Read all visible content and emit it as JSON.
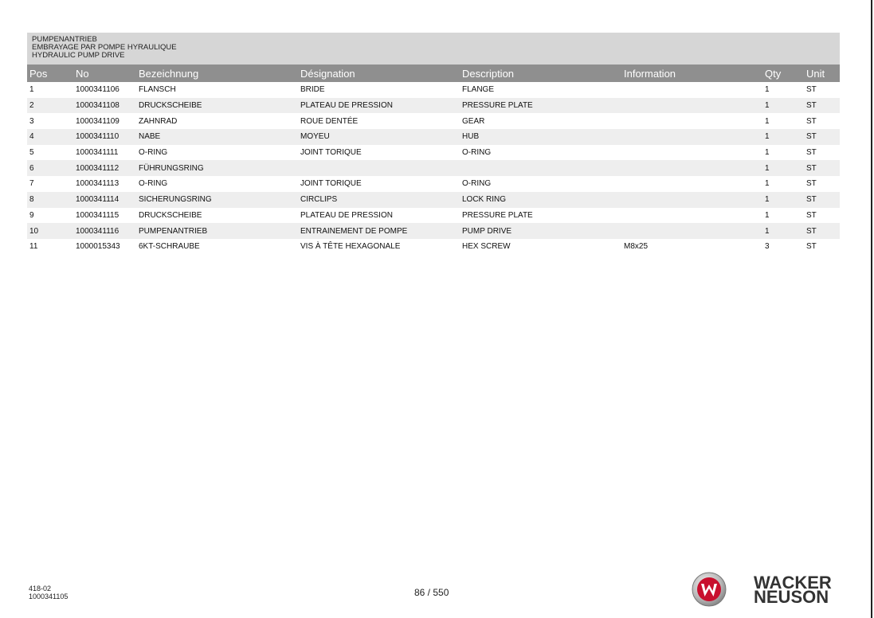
{
  "title": {
    "lines": [
      "PUMPENANTRIEB",
      "EMBRAYAGE PAR POMPE HYRAULIQUE",
      "HYDRAULIC PUMP DRIVE"
    ]
  },
  "table": {
    "headers": [
      "Pos",
      "No",
      "Bezeichnung",
      "Désignation",
      "Description",
      "Information",
      "Qty",
      "Unit"
    ],
    "rows": [
      [
        "1",
        "1000341106",
        "FLANSCH",
        "BRIDE",
        "FLANGE",
        "",
        "1",
        "ST"
      ],
      [
        "2",
        "1000341108",
        "DRUCKSCHEIBE",
        "PLATEAU DE PRESSION",
        "PRESSURE PLATE",
        "",
        "1",
        "ST"
      ],
      [
        "3",
        "1000341109",
        "ZAHNRAD",
        "ROUE DENTÉE",
        "GEAR",
        "",
        "1",
        "ST"
      ],
      [
        "4",
        "1000341110",
        "NABE",
        "MOYEU",
        "HUB",
        "",
        "1",
        "ST"
      ],
      [
        "5",
        "1000341111",
        "O-RING",
        "JOINT TORIQUE",
        "O-RING",
        "",
        "1",
        "ST"
      ],
      [
        "6",
        "1000341112",
        "FÜHRUNGSRING",
        "",
        "",
        "",
        "1",
        "ST"
      ],
      [
        "7",
        "1000341113",
        "O-RING",
        "JOINT TORIQUE",
        "O-RING",
        "",
        "1",
        "ST"
      ],
      [
        "8",
        "1000341114",
        "SICHERUNGSRING",
        "CIRCLIPS",
        "LOCK RING",
        "",
        "1",
        "ST"
      ],
      [
        "9",
        "1000341115",
        "DRUCKSCHEIBE",
        "PLATEAU DE PRESSION",
        "PRESSURE PLATE",
        "",
        "1",
        "ST"
      ],
      [
        "10",
        "1000341116",
        "PUMPENANTRIEB",
        "ENTRAINEMENT DE POMPE",
        "PUMP DRIVE",
        "",
        "1",
        "ST"
      ],
      [
        "11",
        "1000015343",
        "6KT-SCHRAUBE",
        "VIS À TÊTE HEXAGONALE",
        "HEX SCREW",
        "M8x25",
        "3",
        "ST"
      ]
    ]
  },
  "footer": {
    "code_line1": "418-02",
    "code_line2": "1000341105",
    "page": "86 / 550",
    "brand_line1": "WACKER",
    "brand_line2": "NEUSON",
    "logo_icon": "wacker-w-logo-icon",
    "logo_color": "#c8102e"
  }
}
